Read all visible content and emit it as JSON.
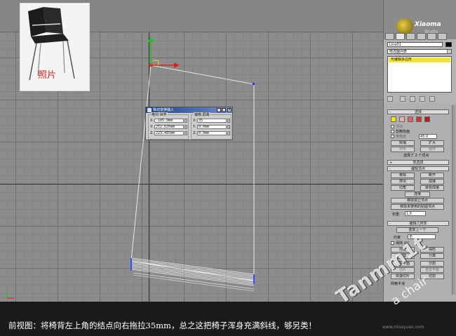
{
  "photo": {
    "label": "照片"
  },
  "dialog": {
    "title": "移动变换输入",
    "absolute_group": "绝对:世界",
    "offset_group": "偏移:屏幕",
    "absolute": [
      {
        "axis": "X:",
        "value": "-185.9mm"
      },
      {
        "axis": "Y:",
        "value": "252.026mm"
      },
      {
        "axis": "Z:",
        "value": "223.485mm"
      }
    ],
    "offset": [
      {
        "axis": "X:",
        "value": "35"
      },
      {
        "axis": "Y:",
        "value": "0.0mm"
      },
      {
        "axis": "Z:",
        "value": "0.0mm"
      }
    ],
    "minimize": "_",
    "restore": "□",
    "close": "×"
  },
  "panel": {
    "logo_brand": "Xiaoma",
    "logo_sub": "Studio",
    "object_name": "Line01",
    "modifier_list": "修改器列表",
    "stack_item": "可编辑多边形",
    "selection_title": "选择",
    "vertex_label": "顶点",
    "ignore_back": "忽略背面",
    "by_angle": "按角度",
    "angle_value": "45.0",
    "shrink": "收缩",
    "grow": "扩大",
    "ring": "环形",
    "loop": "循环",
    "selected_count": "选择了 2 个顶点",
    "soft_selection": "软选择",
    "edit_vertices": "编辑顶点",
    "remove": "移除",
    "break": "断开",
    "extrude": "挤出",
    "weld": "焊接",
    "chamfer": "切角",
    "target_weld": "目标焊接",
    "connect": "连接",
    "remove_isolated": "移除孤立顶点",
    "remove_unused": "移除未使用的贴图顶点",
    "weight_label": "权重:",
    "weight_value": "1.0",
    "edit_geometry": "编辑几何体",
    "repeat_last": "重复上一个",
    "constraints": "约束",
    "constraints_value": "无",
    "preserve_uv": "保持 UV",
    "create": "创建",
    "collapse": "塌陷",
    "attach": "附加",
    "detach": "分离",
    "slice_plane": "切片平面",
    "split": "分割",
    "slice": "切片",
    "reset_plane": "重置平面",
    "quickslice": "快速切片",
    "cut": "切割",
    "mesh_smooth": "网格平滑"
  },
  "caption": "前视图：将椅背左上角的结点向右拖拉35mm，总之这把椅子浑身充满斜线，够另类！",
  "watermark": {
    "text1": "Tanmm1t",
    "text2": "a chair",
    "site": "www.missyuan.com"
  }
}
